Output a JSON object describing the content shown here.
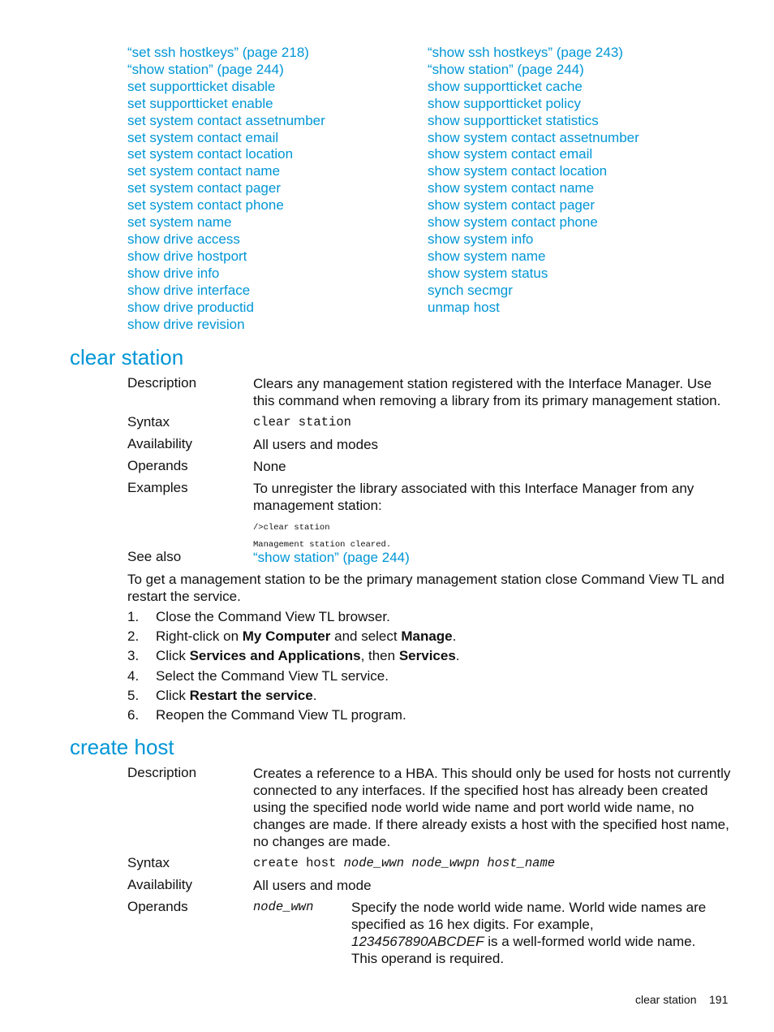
{
  "see_also_links": {
    "left": [
      "“set ssh hostkeys” (page 218)",
      "“show station” (page 244)",
      "set supportticket disable",
      "set supportticket enable",
      "set system contact assetnumber",
      "set system contact email",
      "set system contact location",
      "set system contact name",
      "set system contact pager",
      "set system contact phone",
      "set system name",
      "show drive access",
      "show drive hostport",
      "show drive info",
      "show drive interface",
      "show drive productid",
      "show drive revision"
    ],
    "right": [
      "“show ssh hostkeys” (page 243)",
      "“show station” (page 244)",
      "show supportticket cache",
      "show supportticket policy",
      "show supportticket statistics",
      "show system contact assetnumber",
      "show system contact email",
      "show system contact location",
      "show system contact name",
      "show system contact pager",
      "show system contact phone",
      "show system info",
      "show system name",
      "show system status",
      "synch secmgr",
      "unmap host"
    ]
  },
  "clear_station": {
    "heading": "clear station",
    "description_label": "Description",
    "description": "Clears any management station registered with the Interface Manager. Use this command when removing a library from its primary management station.",
    "syntax_label": "Syntax",
    "syntax": "clear station",
    "availability_label": "Availability",
    "availability": "All users and modes",
    "operands_label": "Operands",
    "operands": "None",
    "examples_label": "Examples",
    "examples": "To unregister the library associated with this Interface Manager from any management station:",
    "example_code": "/>clear station\nManagement station cleared.",
    "see_also_label": "See also",
    "see_also_link": "“show station” (page 244)",
    "restart_intro": "To get a management station to be the primary management station close Command View TL and restart the service.",
    "steps": [
      {
        "n": "1.",
        "pre": "Close the Command View TL browser.",
        "b1": "",
        "mid": "",
        "b2": "",
        "post": ""
      },
      {
        "n": "2.",
        "pre": "Right-click on ",
        "b1": "My Computer",
        "mid": " and select ",
        "b2": "Manage",
        "post": "."
      },
      {
        "n": "3.",
        "pre": "Click ",
        "b1": "Services and Applications",
        "mid": ", then ",
        "b2": "Services",
        "post": "."
      },
      {
        "n": "4.",
        "pre": "Select the Command View TL service.",
        "b1": "",
        "mid": "",
        "b2": "",
        "post": ""
      },
      {
        "n": "5.",
        "pre": "Click ",
        "b1": "Restart the service",
        "mid": "",
        "b2": "",
        "post": "."
      },
      {
        "n": "6.",
        "pre": "Reopen the Command View TL program.",
        "b1": "",
        "mid": "",
        "b2": "",
        "post": ""
      }
    ]
  },
  "create_host": {
    "heading": "create host",
    "description_label": "Description",
    "description": "Creates a reference to a HBA. This should only be used for hosts not currently connected to any interfaces. If the specified host has already been created using the specified node world wide name and port world wide name, no changes are made. If there already exists a host with the specified host name, no changes are made.",
    "syntax_label": "Syntax",
    "syntax_cmd": "create host ",
    "syntax_args": "node_wwn node_wwpn host_name",
    "availability_label": "Availability",
    "availability": "All users and mode",
    "operands_label": "Operands",
    "operand_name": "node_wwn",
    "operand_desc_1": "Specify the node world wide name. World wide names are specified as 16 hex digits. For example, ",
    "operand_example": "1234567890ABCDEF",
    "operand_desc_2": " is a well-formed world wide name. This operand is required."
  },
  "footer": {
    "section": "clear station",
    "page_number": "191"
  }
}
